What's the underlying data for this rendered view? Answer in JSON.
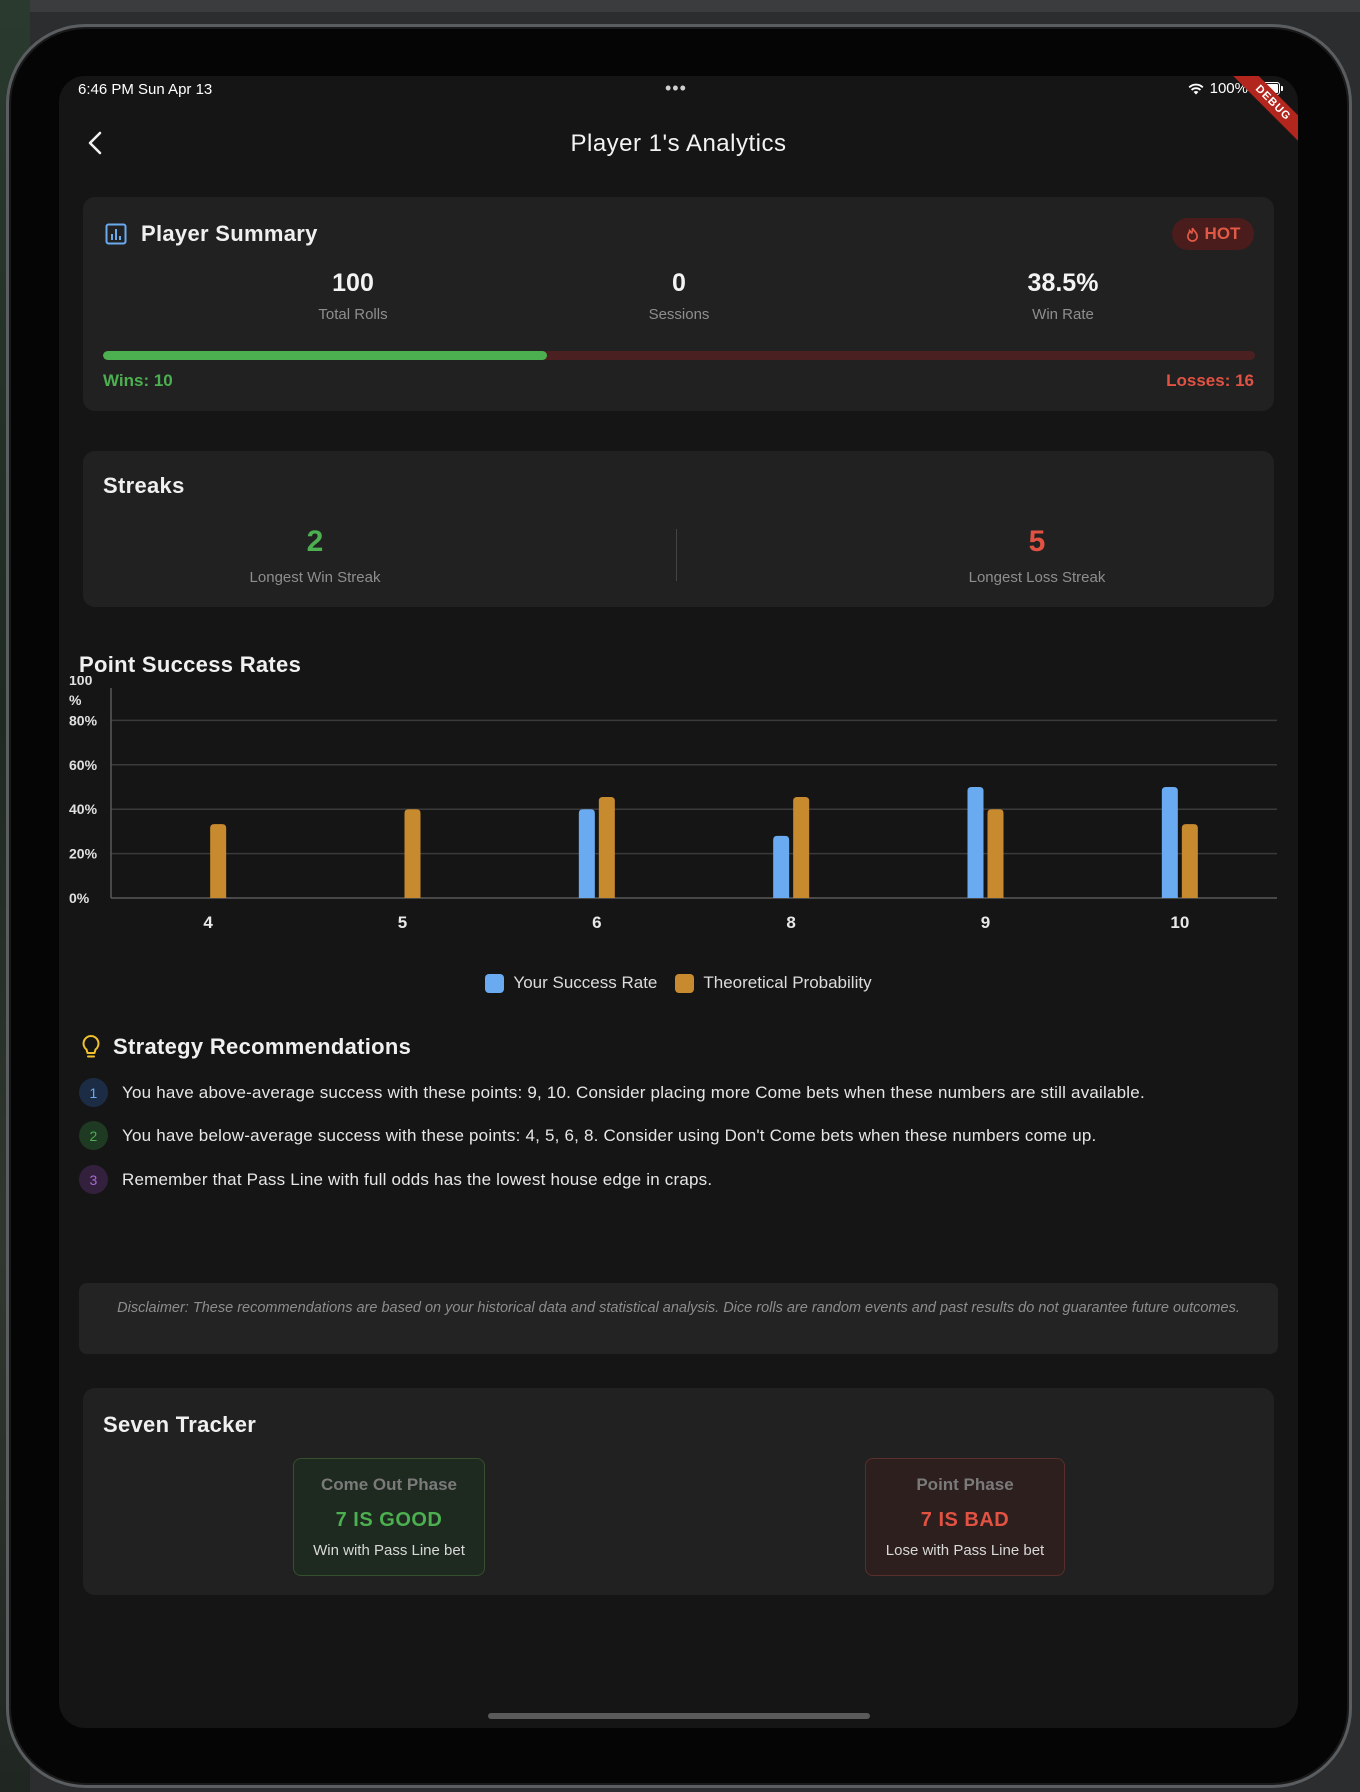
{
  "status": {
    "time": "6:46 PM   Sun Apr 13",
    "battery": "100%",
    "debug": "DEBUG"
  },
  "nav": {
    "title": "Player 1's Analytics"
  },
  "summary": {
    "title": "Player Summary",
    "hot_label": "HOT",
    "stats": [
      {
        "value": "100",
        "label": "Total Rolls"
      },
      {
        "value": "0",
        "label": "Sessions"
      },
      {
        "value": "38.5%",
        "label": "Win Rate"
      }
    ],
    "win_ratio": 0.385,
    "wins": "Wins: 10",
    "losses": "Losses: 16"
  },
  "streaks": {
    "title": "Streaks",
    "win": {
      "value": "2",
      "label": "Longest Win Streak"
    },
    "loss": {
      "value": "5",
      "label": "Longest Loss Streak"
    }
  },
  "colors": {
    "success": "#6aaaf0",
    "theoretical": "#c88a2f",
    "green": "#4caf50",
    "red": "#e25243"
  },
  "chart_data": {
    "type": "bar",
    "title": "Point Success Rates",
    "categories": [
      "4",
      "5",
      "6",
      "8",
      "9",
      "10"
    ],
    "series": [
      {
        "name": "Your Success Rate",
        "values": [
          0,
          0,
          40,
          28,
          50,
          50
        ]
      },
      {
        "name": "Theoretical Probability",
        "values": [
          33.3,
          40,
          45.5,
          45.5,
          40,
          33.3
        ]
      }
    ],
    "y_ticks": [
      "0%",
      "20%",
      "40%",
      "60%",
      "80%",
      "100\n%"
    ],
    "ylim": [
      0,
      100
    ],
    "grid": true,
    "legend": "bottom"
  },
  "strategy": {
    "title": "Strategy Recommendations",
    "items": [
      {
        "num": "1",
        "text": "You have above-average success with these points: 9, 10. Consider placing more Come bets when these numbers are still available."
      },
      {
        "num": "2",
        "text": "You have below-average success with these points: 4, 5, 6, 8. Consider using Don't Come bets when these numbers come up."
      },
      {
        "num": "3",
        "text": "Remember that Pass Line with full odds has the lowest house edge in craps."
      }
    ],
    "disclaimer": "Disclaimer: These recommendations are based on your historical data and statistical analysis. Dice rolls are random events and past results do not guarantee future outcomes."
  },
  "tracker": {
    "title": "Seven Tracker",
    "come_out": {
      "phase": "Come Out Phase",
      "status": "7 IS GOOD",
      "desc": "Win with Pass Line bet"
    },
    "point": {
      "phase": "Point Phase",
      "status": "7 IS BAD",
      "desc": "Lose with Pass Line bet"
    }
  }
}
